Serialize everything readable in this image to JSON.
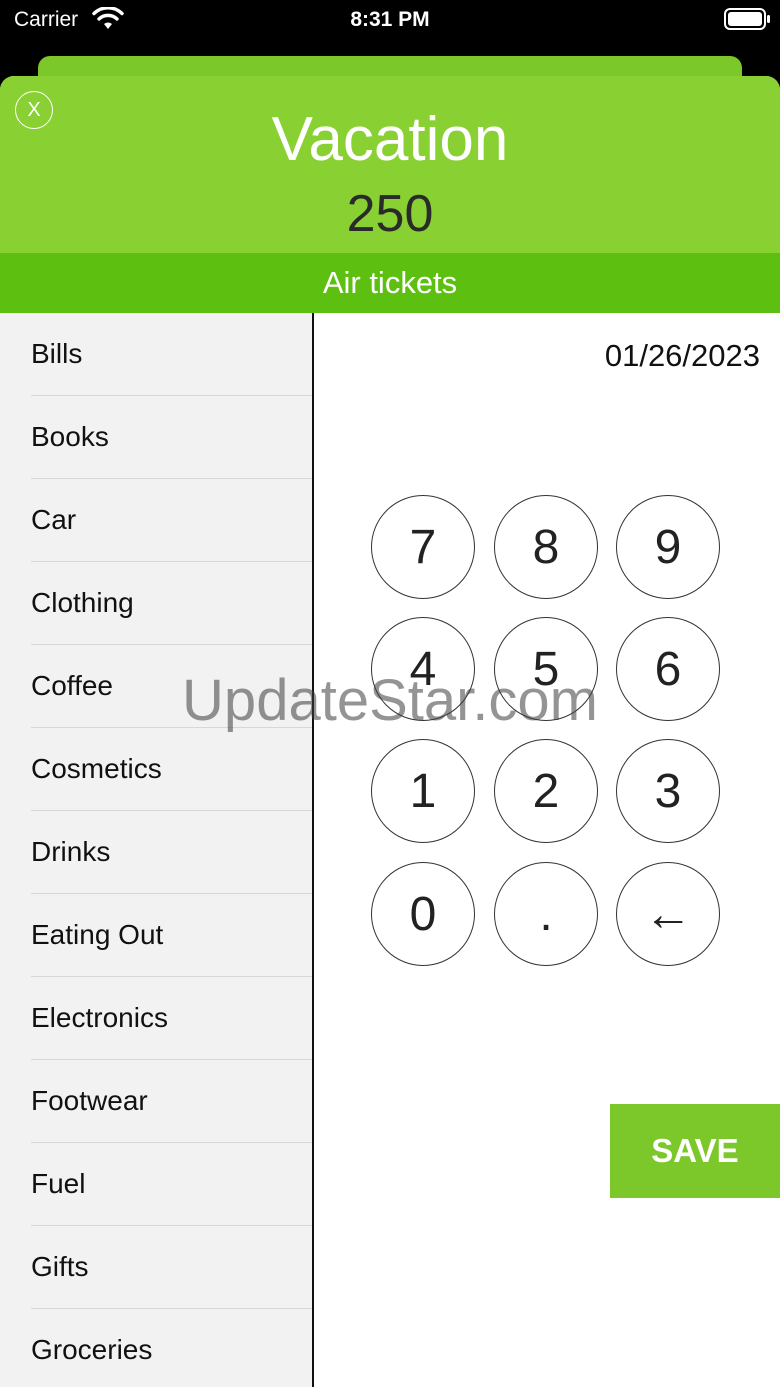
{
  "status_bar": {
    "carrier": "Carrier",
    "time": "8:31 PM"
  },
  "header": {
    "close_label": "X",
    "title": "Vacation",
    "amount": "250"
  },
  "subcategory": "Air tickets",
  "categories": [
    "Bills",
    "Books",
    "Car",
    "Clothing",
    "Coffee",
    "Cosmetics",
    "Drinks",
    "Eating Out",
    "Electronics",
    "Footwear",
    "Fuel",
    "Gifts",
    "Groceries"
  ],
  "date": "01/26/2023",
  "keypad": {
    "keys": [
      "7",
      "8",
      "9",
      "4",
      "5",
      "6",
      "1",
      "2",
      "3",
      "0",
      ".",
      "←"
    ]
  },
  "save_label": "SAVE",
  "watermark": "UpdateStar.com",
  "colors": {
    "header": "#89d033",
    "subbar": "#5dc011",
    "save": "#7cc82b"
  }
}
